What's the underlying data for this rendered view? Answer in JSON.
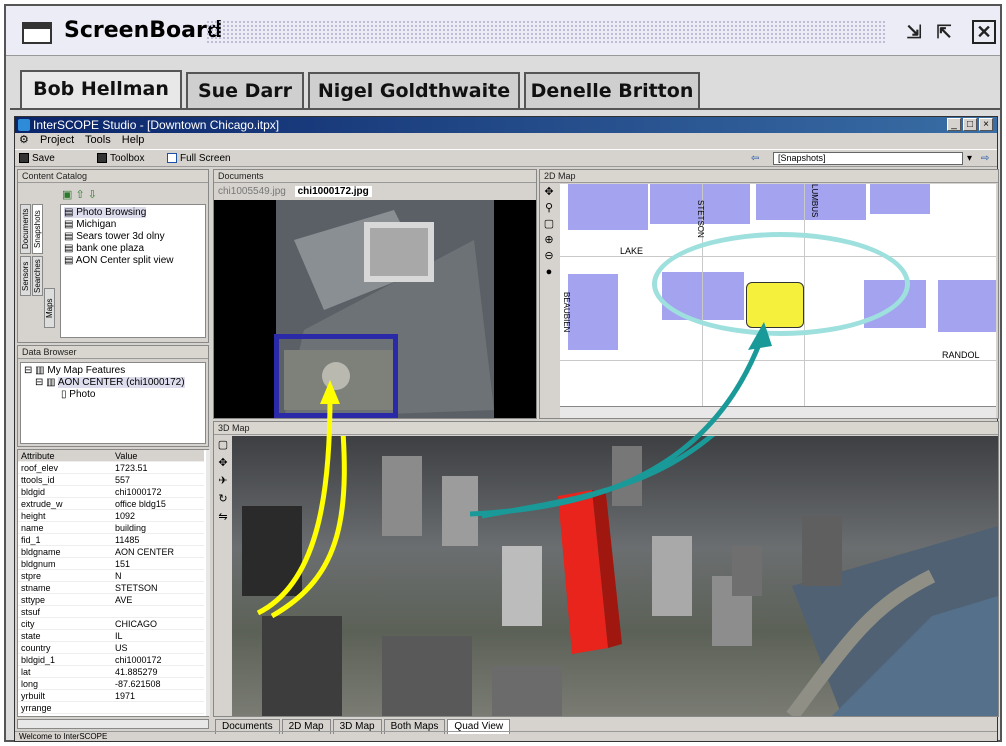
{
  "screenboard": {
    "title": "ScreenBoard",
    "tabs": [
      "Bob Hellman",
      "Sue Darr",
      "Nigel Goldthwaite",
      "Denelle Britton"
    ],
    "active_tab": 0
  },
  "app": {
    "title": "InterSCOPE Studio - [Downtown Chicago.itpx]",
    "menu": [
      "Project",
      "Tools",
      "Help"
    ],
    "toolbar": {
      "save": "Save",
      "toolbox": "Toolbox",
      "fullscreen": "Full Screen",
      "snapshots": "[Snapshots]"
    },
    "content_catalog": {
      "title": "Content Catalog",
      "vtabs": [
        "Documents",
        "Snapshots",
        "Sensors",
        "Searches",
        "Maps"
      ],
      "items": [
        "Photo Browsing",
        "Michigan",
        "Sears tower 3d olny",
        "bank one plaza",
        "AON Center split view"
      ]
    },
    "data_browser": {
      "title": "Data Browser",
      "tree": [
        "My Map Features",
        "AON CENTER (chi1000172)",
        "Photo"
      ]
    },
    "attributes": {
      "headers": [
        "Attribute",
        "Value"
      ],
      "rows": [
        [
          "roof_elev",
          "1723.51"
        ],
        [
          "ttools_id",
          "557"
        ],
        [
          "bldgid",
          "chi1000172"
        ],
        [
          "extrude_w",
          "office bldg15"
        ],
        [
          "height",
          "1092"
        ],
        [
          "name",
          "building"
        ],
        [
          "fid_1",
          "11485"
        ],
        [
          "bldgname",
          "AON CENTER"
        ],
        [
          "bldgnum",
          "151"
        ],
        [
          "stpre",
          "N"
        ],
        [
          "stname",
          "STETSON"
        ],
        [
          "sttype",
          "AVE"
        ],
        [
          "stsuf",
          ""
        ],
        [
          "city",
          "CHICAGO"
        ],
        [
          "state",
          "IL"
        ],
        [
          "country",
          "US"
        ],
        [
          "bldgid_1",
          "chi1000172"
        ],
        [
          "lat",
          "41.885279"
        ],
        [
          "long",
          "-87.621508"
        ],
        [
          "yrbuilt",
          "1971"
        ],
        [
          "yrrange",
          ""
        ]
      ]
    },
    "documents": {
      "title": "Documents",
      "tabs": [
        "chi1005549.jpg",
        "chi1000172.jpg"
      ],
      "active_tab": 1
    },
    "map2d": {
      "title": "2D Map",
      "streets": [
        "STETSON",
        "LUMBUS",
        "LAKE",
        "BEAUBIEN",
        "RANDOL"
      ]
    },
    "map3d": {
      "title": "3D Map"
    },
    "view_tabs": [
      "Documents",
      "2D Map",
      "3D Map",
      "Both Maps",
      "Quad View"
    ],
    "active_view": 4,
    "status": "Welcome to InterSCOPE"
  },
  "colors": {
    "arrow_yellow": "#ffff00",
    "arrow_teal": "#1a9999",
    "highlight_box": "#2a2aa8",
    "ellipse": "#9ee0de",
    "selected_building": "#f4f03c",
    "tower_red": "#e8241c"
  }
}
